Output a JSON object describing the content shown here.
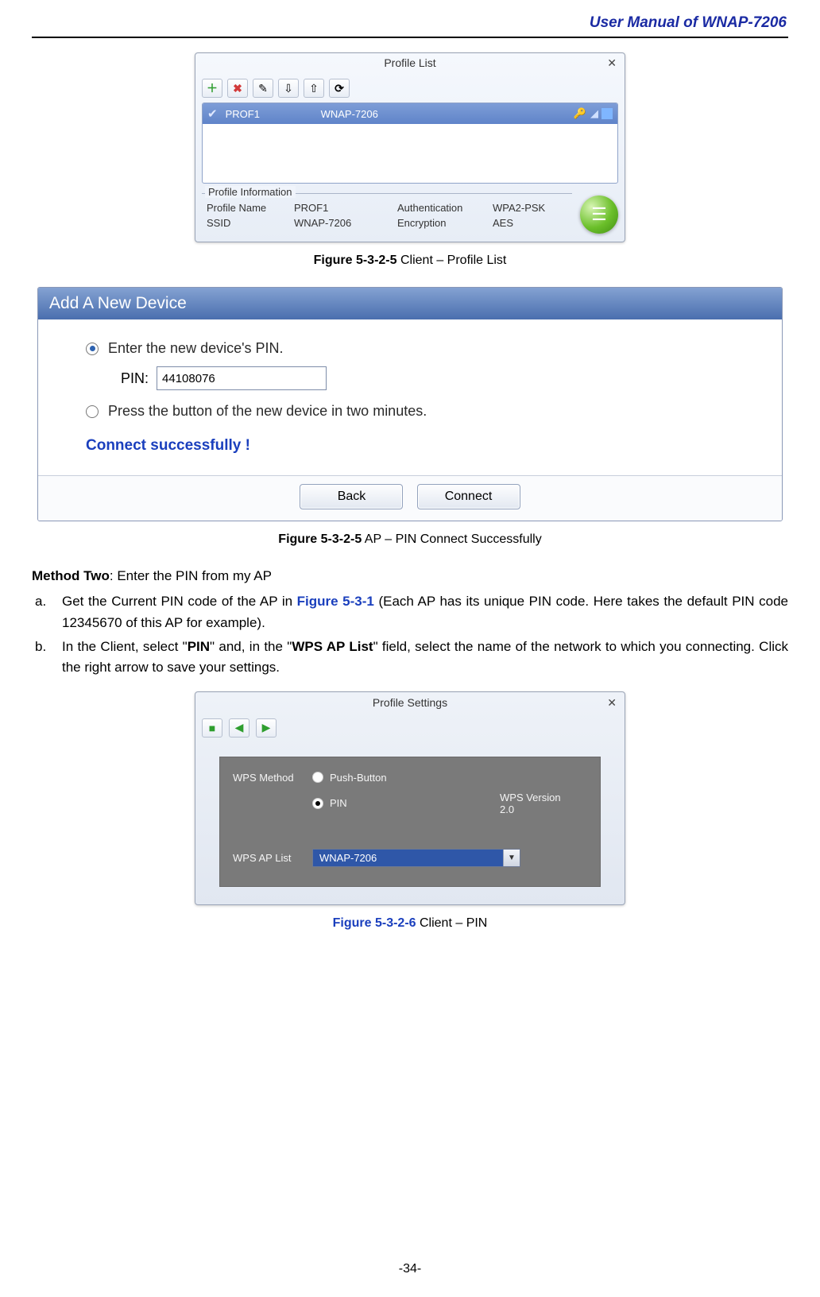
{
  "header": {
    "title": "User Manual of WNAP-7206"
  },
  "fig1": {
    "win_title": "Profile List",
    "toolbar_icons": [
      "plus-icon",
      "x-icon",
      "edit-icon",
      "import-icon",
      "export-icon",
      "refresh-icon"
    ],
    "row": {
      "name": "PROF1",
      "ssid": "WNAP-7206"
    },
    "info": {
      "legend": "Profile Information",
      "profile_name_label": "Profile Name",
      "profile_name_val": "PROF1",
      "ssid_label": "SSID",
      "ssid_val": "WNAP-7206",
      "auth_label": "Authentication",
      "auth_val": "WPA2-PSK",
      "enc_label": "Encryption",
      "enc_val": "AES"
    },
    "caption_num": "Figure 5-3-2-5",
    "caption_txt": " Client – Profile List"
  },
  "fig2": {
    "title": "Add A New Device",
    "opt1": "Enter the new device's PIN.",
    "pin_label": "PIN:",
    "pin_value": "44108076",
    "opt2": "Press the button of the new device in two minutes.",
    "status": "Connect successfully !",
    "btn_back": "Back",
    "btn_connect": "Connect",
    "caption_num": "Figure 5-3-2-5",
    "caption_txt": " AP – PIN Connect Successfully"
  },
  "body": {
    "method_two_bold": "Method Two",
    "method_two_rest": ": Enter the PIN from my AP",
    "a_pre": "Get the Current PIN code of the AP in ",
    "a_ref": "Figure 5-3-1",
    "a_post": " (Each AP has its unique PIN code. Here takes the default PIN code 12345670 of this AP for example).",
    "b_pre": "In the Client, select \"",
    "b_pin": "PIN",
    "b_mid": "\" and, in the \"",
    "b_wps": "WPS AP List",
    "b_post": "\" field, select the name of the network to which you connecting. Click the right arrow to save your settings."
  },
  "fig3": {
    "win_title": "Profile Settings",
    "wps_method_label": "WPS Method",
    "opt_push": "Push-Button",
    "opt_pin": "PIN",
    "wps_ver_label": "WPS Version",
    "wps_ver_val": "2.0",
    "aplist_label": "WPS AP List",
    "aplist_val": "WNAP-7206",
    "caption_num": "Figure 5-3-2-6",
    "caption_txt": " Client – PIN"
  },
  "footer": {
    "pagenum": "-34-"
  }
}
